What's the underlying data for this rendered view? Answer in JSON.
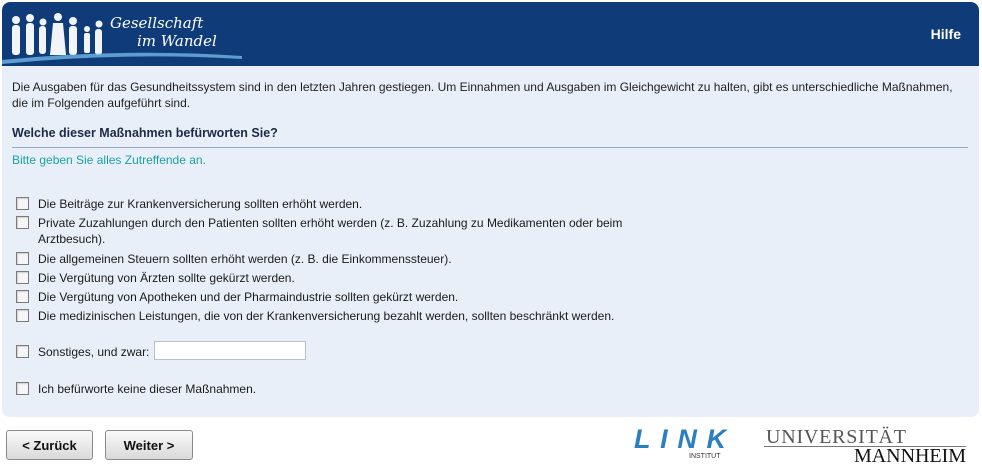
{
  "header": {
    "logo_line1": "Gesellschaft",
    "logo_line2": "im Wandel",
    "help_label": "Hilfe"
  },
  "intro": "Die Ausgaben für das Gesundheitssystem sind in den letzten Jahren gestiegen. Um Einnahmen und Ausgaben im Gleichgewicht zu halten, gibt es unterschiedliche Maßnahmen, die im Folgenden aufgeführt sind.",
  "question": "Welche dieser Maßnahmen befürworten Sie?",
  "hint": "Bitte geben Sie alles Zutreffende an.",
  "options": [
    {
      "label": "Die Beiträge zur Krankenversicherung sollten erhöht werden.",
      "checked": false
    },
    {
      "label": "Private Zuzahlungen durch den Patienten sollten erhöht werden (z. B. Zuzahlung zu Medikamenten oder beim Arztbesuch).",
      "checked": false
    },
    {
      "label": "Die allgemeinen Steuern sollten erhöht werden (z. B. die Einkommenssteuer).",
      "checked": false
    },
    {
      "label": "Die Vergütung von Ärzten sollte gekürzt werden.",
      "checked": false
    },
    {
      "label": "Die Vergütung von Apotheken und der Pharmaindustrie sollten gekürzt werden.",
      "checked": false
    },
    {
      "label": "Die medizinischen Leistungen, die von der Krankenversicherung bezahlt werden, sollten beschränkt werden.",
      "checked": false
    }
  ],
  "other": {
    "label": "Sonstiges, und zwar:",
    "value": "",
    "checked": false
  },
  "none_option": {
    "label": "Ich befürworte keine dieser Maßnahmen.",
    "checked": false
  },
  "nav": {
    "back_label": "< Zurück",
    "next_label": "Weiter >"
  },
  "footer": {
    "link_logo_text": "LINK",
    "link_logo_sub": "INSTITUT",
    "uni_line1": "UNIVERSITÄT",
    "uni_line2": "MANNHEIM"
  },
  "colors": {
    "header_bg": "#0f3c78",
    "panel_bg": "#e9eff8",
    "hint": "#1aa0a6",
    "link_logo": "#2a7fc1"
  }
}
